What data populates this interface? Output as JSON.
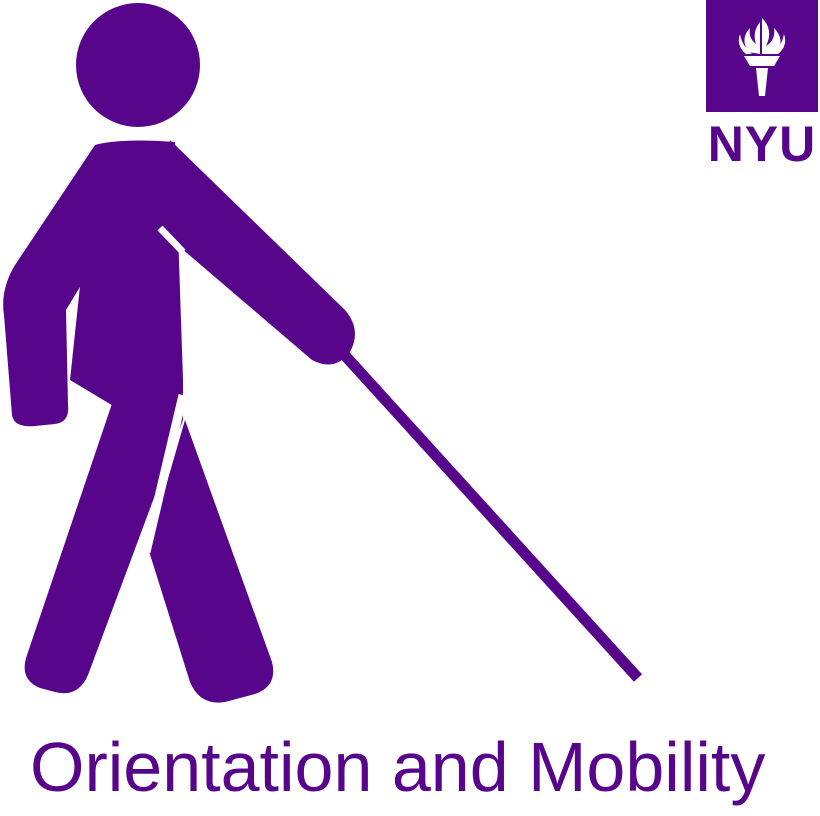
{
  "logo": {
    "text": "NYU",
    "icon": "torch-icon"
  },
  "caption": "Orientation and Mobility",
  "figure": {
    "icon": "person-with-cane-icon"
  },
  "colors": {
    "brand": "#57068c",
    "background": "#ffffff"
  }
}
